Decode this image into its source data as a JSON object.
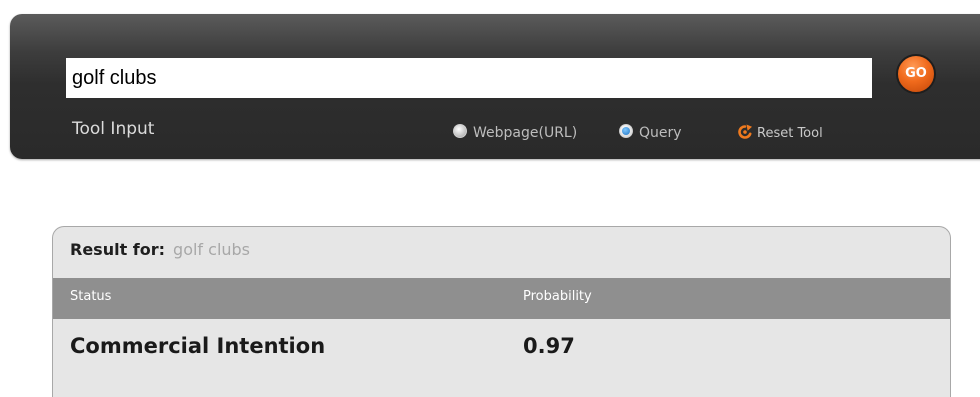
{
  "search": {
    "value": "golf clubs",
    "go_label": "GO",
    "tool_input_label": "Tool Input"
  },
  "mode_options": {
    "webpage_label": "Webpage(URL)",
    "query_label": "Query",
    "selected": "Query",
    "reset_label": "Reset Tool"
  },
  "result": {
    "for_label": "Result for:",
    "query": "golf clubs",
    "columns": [
      "Status",
      "Probability"
    ],
    "rows": [
      {
        "status": "Commercial Intention",
        "probability": "0.97"
      }
    ]
  },
  "colors": {
    "accent": "#f06a1c",
    "panel_dark": "#2e2e2e",
    "header_gray": "#8f8f8f",
    "result_bg": "#e6e6e6",
    "radio_selected": "#1f74c4"
  },
  "icons": {
    "reset": "reset-icon",
    "radio": "radio-icon"
  }
}
